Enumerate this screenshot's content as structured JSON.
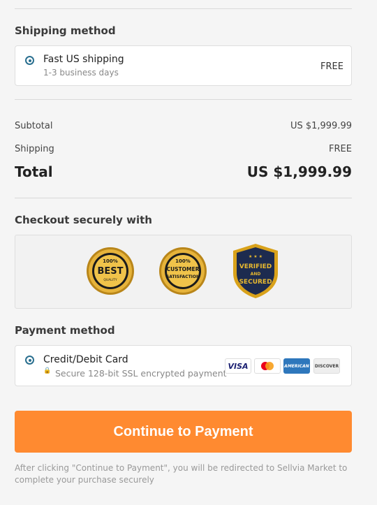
{
  "shipping": {
    "section_title": "Shipping method",
    "option_label": "Fast US shipping",
    "option_sub": "1-3 business days",
    "option_price": "FREE"
  },
  "summary": {
    "subtotal_label": "Subtotal",
    "subtotal_value": "US $1,999.99",
    "shipping_label": "Shipping",
    "shipping_value": "FREE",
    "total_label": "Total",
    "total_value": "US $1,999.99"
  },
  "secure": {
    "section_title": "Checkout securely with",
    "badges": [
      {
        "line1": "100%",
        "line2": "BEST",
        "line3": "QUALITY"
      },
      {
        "line1": "100%",
        "line2": "CUSTOMER",
        "line3": "SATISFACTION"
      },
      {
        "line1": "★ ★ ★",
        "line2": "VERIFIED",
        "line3": "AND",
        "line4": "SECURED"
      }
    ]
  },
  "payment": {
    "section_title": "Payment method",
    "option_label": "Credit/Debit Card",
    "option_sub": "Secure 128-bit SSL encrypted payment",
    "cards": {
      "visa": "VISA",
      "amex": "AMERICAN",
      "discover": "DISCOVER"
    }
  },
  "cta": {
    "label": "Continue to Payment"
  },
  "note": {
    "text": "After clicking \"Continue to Payment\", you will be redirected to Sellvia Market to complete your purchase securely"
  },
  "colors": {
    "accent": "#ff8a30",
    "radio": "#2a6f8f",
    "gold": "#d9a21b",
    "shield_navy": "#1d2b4f"
  }
}
